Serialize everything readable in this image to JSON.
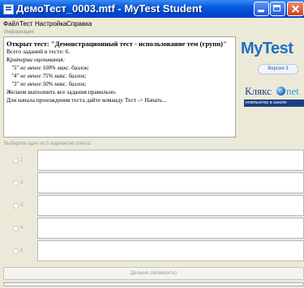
{
  "window": {
    "title": "ДемоТест_0003.mtf - MyTest Student"
  },
  "menu": {
    "items": [
      "Файл",
      "Тест",
      "Настройка",
      "Справка"
    ]
  },
  "info": {
    "caption": "Информация",
    "heading": "Открыт тест: \"Демонстрационный тест - использование тем (групп)\"",
    "task_count": "Всего заданий в тесте: 6.",
    "criteria_title": "Критерии оценивания:",
    "criteria": [
      "\"5\" не менее 100% макс. баллов;",
      "\"4\" не менее 75% макс. баллов;",
      "\"3\" не менее 50% макс. баллов;"
    ],
    "wish": "Желаем выполнить все задания правильно.",
    "start_hint": "Для начала прохождения теста дайте команду Тест -> Начать..."
  },
  "logos": {
    "mytest": "MyTest",
    "version": "Версия 3",
    "klyaks": "Клякс",
    "net": "net",
    "klyaks_tagline": "компьютер в школе"
  },
  "answers": {
    "caption": "Выберите один из 5 вариантов ответа:",
    "options": [
      {
        "num": "1",
        "text": ""
      },
      {
        "num": "2",
        "text": ""
      },
      {
        "num": "3",
        "text": ""
      },
      {
        "num": "4",
        "text": ""
      },
      {
        "num": "5",
        "text": ""
      }
    ]
  },
  "buttons": {
    "next": "Дальше (проверить)"
  },
  "colors": {
    "titlebar": "#0a5fe0",
    "window_bg": "#ece9d8",
    "mytest_blue": "#1f6fc0",
    "klyaks_navy": "#1b3f84"
  }
}
